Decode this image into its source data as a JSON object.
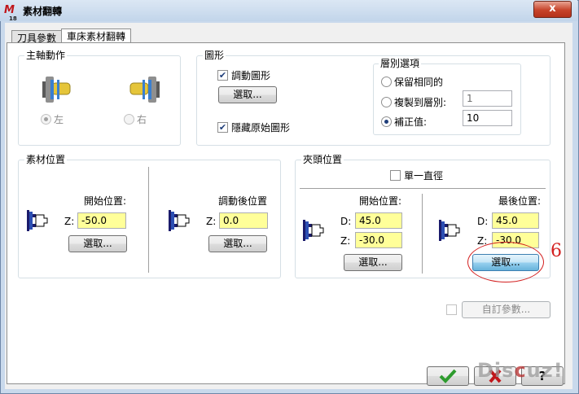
{
  "window": {
    "title": "素材翻轉",
    "close_label": "x",
    "app_icon_label": "18"
  },
  "tabs": [
    {
      "label": "刀具參數"
    },
    {
      "label": "車床素材翻轉"
    }
  ],
  "spindle_group": {
    "title": "主軸動作",
    "left_label": "左",
    "right_label": "右",
    "selected": "左"
  },
  "geometry_group": {
    "title": "圖形",
    "move_geometry_label": "調動圖形",
    "move_geometry_checked": true,
    "select_label": "選取...",
    "hide_original_label": "隱藏原始圖形",
    "hide_original_checked": true
  },
  "layer_group": {
    "title": "層別選項",
    "keep_same_label": "保留相同的",
    "copy_to_layer_label": "複製到層別:",
    "copy_to_layer_value": "1",
    "offset_label": "補正值:",
    "offset_value": "10",
    "selected": "補正值:"
  },
  "stock_group": {
    "title": "素材位置",
    "start_label": "開始位置:",
    "start_z_label": "Z:",
    "start_z_value": "-50.0",
    "start_select_label": "選取...",
    "after_label": "調動後位置",
    "after_z_label": "Z:",
    "after_z_value": "0.0",
    "after_select_label": "選取..."
  },
  "chuck_group": {
    "title": "夾頭位置",
    "single_diameter_label": "單一直徑",
    "single_diameter_checked": false,
    "start_label": "開始位置:",
    "start_d_label": "D:",
    "start_d_value": "45.0",
    "start_z_label": "Z:",
    "start_z_value": "-30.0",
    "start_select_label": "選取...",
    "final_label": "最後位置:",
    "final_d_label": "D:",
    "final_d_value": "45.0",
    "final_z_label": "Z:",
    "final_z_value": "-30.0",
    "final_select_label": "選取..."
  },
  "custom_params": {
    "label": "自訂參數...",
    "checked": false
  },
  "footer": {
    "ok_icon": "checkmark-icon",
    "help_label": "?"
  },
  "annotation": {
    "number": "6",
    "color": "#d32020"
  },
  "watermark": {
    "text_pre": "Dis",
    "text_x": "c",
    "text_post": "uz!"
  },
  "colors": {
    "input_highlight": "#ffff99",
    "window_frame": "#c9d9ec",
    "ok_green": "#2e9b2e"
  }
}
